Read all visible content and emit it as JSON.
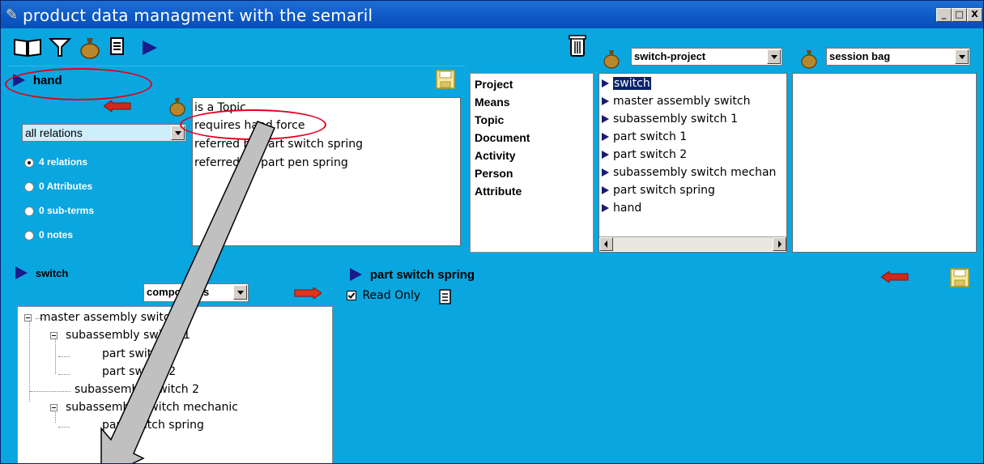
{
  "window": {
    "title": "product data managment with the semaril",
    "min_label": "_",
    "max_label": "□",
    "close_label": "X"
  },
  "toolbar": {
    "icons": [
      "book-icon",
      "filter-icon",
      "bag-icon",
      "document-icon",
      "play-icon"
    ],
    "trash_icon": "trash-icon"
  },
  "term_panel": {
    "title": "hand",
    "relation_filter": "all relations",
    "radios": [
      {
        "label": "4 relations",
        "checked": true
      },
      {
        "label": "0 Attributes",
        "checked": false
      },
      {
        "label": "0 sub-terms",
        "checked": false
      },
      {
        "label": "0 notes",
        "checked": false
      }
    ],
    "relations": [
      "is a Topic",
      "requires hand force",
      "referred by part switch spring",
      "referred by part pen spring"
    ]
  },
  "categories": [
    "Project",
    "Means",
    "Topic",
    "Document",
    "Activity",
    "Person",
    "Attribute"
  ],
  "project_panel": {
    "selected_project": "switch-project",
    "items": [
      "switch",
      "master assembly switch",
      "subassembly switch 1",
      "part switch 1",
      "part switch 2",
      "subassembly switch mechan",
      "part switch spring",
      "hand"
    ],
    "selected_index": 0
  },
  "session_panel": {
    "selected": "session bag"
  },
  "tree_panel": {
    "title": "switch",
    "view_select": "components",
    "nodes": [
      {
        "label": "master assembly switch",
        "level": 0,
        "expander": true
      },
      {
        "label": "subassembly switch 1",
        "level": 1,
        "expander": true
      },
      {
        "label": "part switch 1",
        "level": 2,
        "expander": false
      },
      {
        "label": "part switch 2",
        "level": 2,
        "expander": false
      },
      {
        "label": "subassembly switch 2",
        "level": 1,
        "expander": false
      },
      {
        "label": "subassembly switch mechanic",
        "level": 1,
        "expander": true
      },
      {
        "label": "part switch spring",
        "level": 2,
        "expander": false
      }
    ]
  },
  "detail_panel": {
    "title": "part switch spring",
    "read_only_label": "Read Only",
    "read_only_checked": true
  },
  "colors": {
    "panel_blue": "#0aa6e0",
    "annotation_red": "#e3001b",
    "title_blue": "#0c58c4",
    "selection": "#0a246a"
  }
}
